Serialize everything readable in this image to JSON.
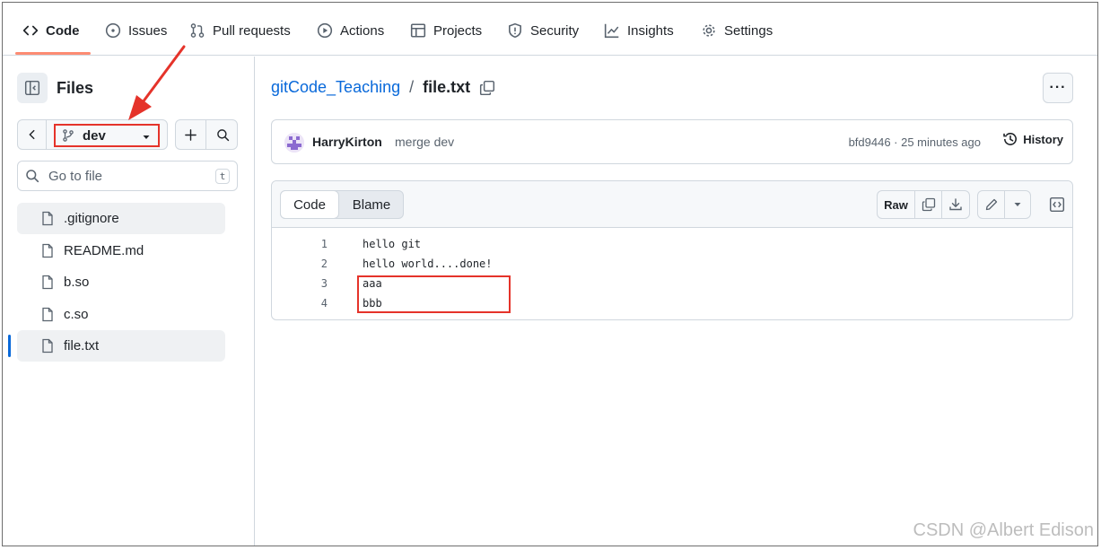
{
  "nav": {
    "tabs": [
      {
        "label": "Code",
        "icon": "code-icon"
      },
      {
        "label": "Issues",
        "icon": "issue-icon"
      },
      {
        "label": "Pull requests",
        "icon": "pull-request-icon"
      },
      {
        "label": "Actions",
        "icon": "play-icon"
      },
      {
        "label": "Projects",
        "icon": "table-icon"
      },
      {
        "label": "Security",
        "icon": "shield-icon"
      },
      {
        "label": "Insights",
        "icon": "graph-icon"
      },
      {
        "label": "Settings",
        "icon": "gear-icon"
      }
    ],
    "active_tab": "Code",
    "accent_color": "#fd8c73"
  },
  "sidebar": {
    "title": "Files",
    "branch": "dev",
    "search_placeholder": "Go to file",
    "search_shortcut": "t",
    "files": [
      {
        "name": ".gitignore"
      },
      {
        "name": "README.md"
      },
      {
        "name": "b.so"
      },
      {
        "name": "c.so"
      },
      {
        "name": "file.txt"
      }
    ],
    "selected_file": "file.txt"
  },
  "breadcrumb": {
    "repo": "gitCode_Teaching",
    "separator": "/",
    "file": "file.txt"
  },
  "commit": {
    "author": "HarryKirton",
    "message": "merge dev",
    "meta": "bfd9446 · 25 minutes ago",
    "history_label": "History"
  },
  "code_view": {
    "tab_code": "Code",
    "tab_blame": "Blame",
    "raw_label": "Raw",
    "lines": [
      {
        "number": "1",
        "text": "hello git"
      },
      {
        "number": "2",
        "text": "hello world....done!"
      },
      {
        "number": "3",
        "text": "aaa"
      },
      {
        "number": "4",
        "text": "bbb"
      }
    ]
  },
  "annotations": {
    "highlight_color": "#e5332a"
  },
  "watermark": "CSDN @Albert Edison"
}
